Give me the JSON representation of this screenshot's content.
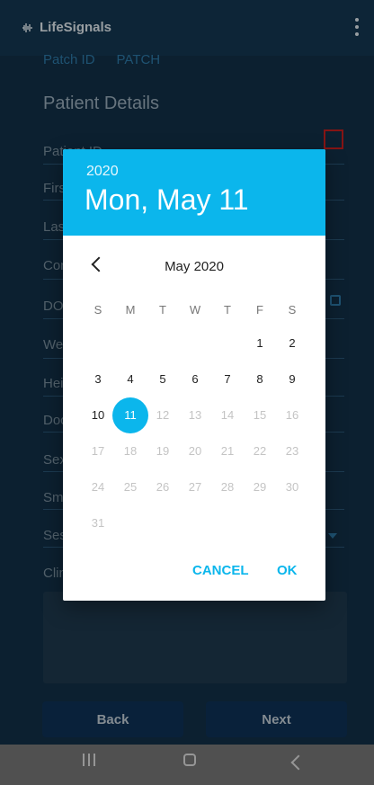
{
  "app": {
    "brand": "LifeSignals",
    "patch_label_1": "Patch ID",
    "patch_label_2": "PATCH",
    "section_title": "Patient Details",
    "fields": [
      "Patient ID",
      "Firs",
      "Las",
      "Con",
      "DO",
      "We",
      "Hei",
      "Doc",
      "Sex",
      "Sm",
      "Ses",
      "Clin"
    ],
    "buttons": {
      "back": "Back",
      "next": "Next"
    }
  },
  "dialog": {
    "year": "2020",
    "date_title": "Mon, May 11",
    "month_label": "May 2020",
    "weekdays": [
      "S",
      "M",
      "T",
      "W",
      "T",
      "F",
      "S"
    ],
    "days": [
      "1",
      "2",
      "3",
      "4",
      "5",
      "6",
      "7",
      "8",
      "9",
      "10",
      "11",
      "12",
      "13",
      "14",
      "15",
      "16",
      "17",
      "18",
      "19",
      "20",
      "21",
      "22",
      "23",
      "24",
      "25",
      "26",
      "27",
      "28",
      "29",
      "30",
      "31"
    ],
    "selected_day": "11",
    "cancel": "CANCEL",
    "ok": "OK"
  },
  "colors": {
    "accent": "#0bb6ec",
    "background": "#13324a",
    "disabled_day": "#c4c4c4"
  }
}
